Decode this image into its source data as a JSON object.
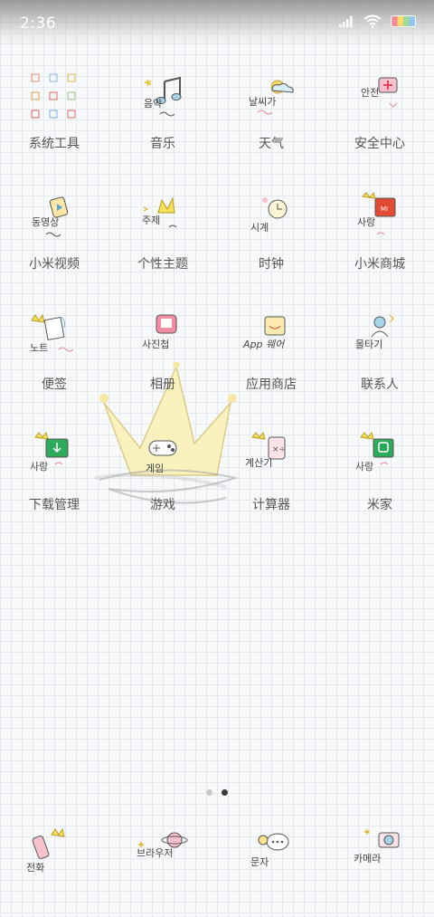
{
  "status": {
    "time": "2:36"
  },
  "apps": [
    {
      "label": "系统工具",
      "name": "app-system-tools",
      "icon": "tools-folder-icon"
    },
    {
      "label": "音乐",
      "name": "app-music",
      "icon": "music-icon",
      "art": "음악"
    },
    {
      "label": "天气",
      "name": "app-weather",
      "icon": "weather-icon",
      "art": "날씨가"
    },
    {
      "label": "安全中心",
      "name": "app-security-center",
      "icon": "security-icon",
      "art": "안전"
    },
    {
      "label": "小米视频",
      "name": "app-mi-video",
      "icon": "video-icon",
      "art": "동영상"
    },
    {
      "label": "个性主题",
      "name": "app-themes",
      "icon": "theme-crown-icon",
      "art": "주제"
    },
    {
      "label": "时钟",
      "name": "app-clock",
      "icon": "clock-icon",
      "art": "시계"
    },
    {
      "label": "小米商城",
      "name": "app-mi-store",
      "icon": "store-icon",
      "art": "사랑"
    },
    {
      "label": "便签",
      "name": "app-notes",
      "icon": "notes-icon",
      "art": "노트"
    },
    {
      "label": "相册",
      "name": "app-gallery",
      "icon": "gallery-icon",
      "art": "사진첩"
    },
    {
      "label": "应用商店",
      "name": "app-app-store",
      "icon": "app-store-icon",
      "art": "App 웨어"
    },
    {
      "label": "联系人",
      "name": "app-contacts",
      "icon": "contacts-icon",
      "art": "몰타기"
    },
    {
      "label": "下载管理",
      "name": "app-downloads",
      "icon": "download-icon",
      "art": "사랑"
    },
    {
      "label": "游戏",
      "name": "app-games",
      "icon": "gamepad-icon",
      "art": "게임"
    },
    {
      "label": "计算器",
      "name": "app-calculator",
      "icon": "calculator-icon",
      "art": "계산기"
    },
    {
      "label": "米家",
      "name": "app-mijia",
      "icon": "mijia-icon",
      "art": "사랑"
    }
  ],
  "dock": [
    {
      "name": "dock-phone",
      "icon": "phone-icon",
      "art": "전화"
    },
    {
      "name": "dock-browser",
      "icon": "browser-planet-icon",
      "art": "브라우저"
    },
    {
      "name": "dock-messages",
      "icon": "message-bubble-icon",
      "art": "문자"
    },
    {
      "name": "dock-camera",
      "icon": "camera-icon",
      "art": "카메라"
    }
  ],
  "page_indicator": {
    "total": 2,
    "current": 2
  },
  "colors": {
    "yellow": "#f6d94a",
    "green": "#2eaa5c",
    "red": "#e34a33",
    "pink": "#f08aa0",
    "blue": "#7ab6e8"
  }
}
